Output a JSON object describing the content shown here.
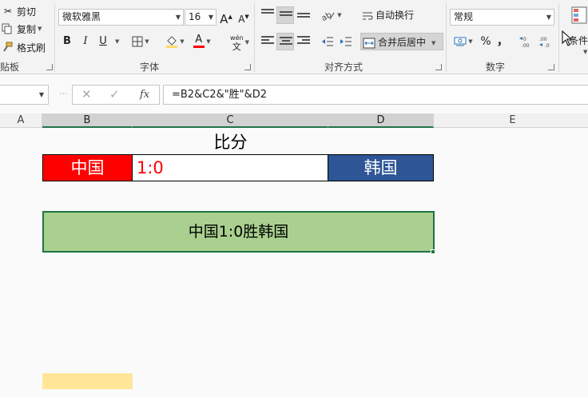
{
  "ribbon": {
    "clipboard": {
      "cut_label": "剪切",
      "copy_label": "复制",
      "format_painter_label": "格式刷",
      "group_label": "贴板"
    },
    "font": {
      "font_name": "微软雅黑",
      "font_size": "16",
      "grow_label": "A",
      "shrink_label": "A",
      "bold_label": "B",
      "italic_label": "I",
      "underline_label": "U",
      "font_color_label": "A",
      "phonetic_label": "wén",
      "phonetic_sub": "文",
      "group_label": "字体",
      "font_color": "#ff0000"
    },
    "alignment": {
      "wrap_text_label": "自动换行",
      "merge_center_label": "合并后居中",
      "group_label": "对齐方式"
    },
    "number": {
      "format_value": "常规",
      "percent_label": "%",
      "comma_label": "，",
      "group_label": "数字"
    },
    "styles": {
      "conditional_label": "条件格"
    }
  },
  "formula_bar": {
    "name_box": "",
    "cancel_label": "✕",
    "enter_label": "✓",
    "fx_label": "fx",
    "formula": "=B2&C2&\"胜\"&D2"
  },
  "columns": [
    "A",
    "B",
    "C",
    "D",
    "E"
  ],
  "sheet": {
    "title": "比分",
    "team_a": "中国",
    "score": "1:0",
    "team_b": "韩国",
    "result": "中国1:0胜韩国",
    "colors": {
      "team_a_fill": "#ff0000",
      "score_text": "#ff0000",
      "team_b_fill": "#2e5596",
      "result_fill": "#a9d08e",
      "selection_border": "#217346",
      "yellow_fill": "#ffe699"
    }
  }
}
